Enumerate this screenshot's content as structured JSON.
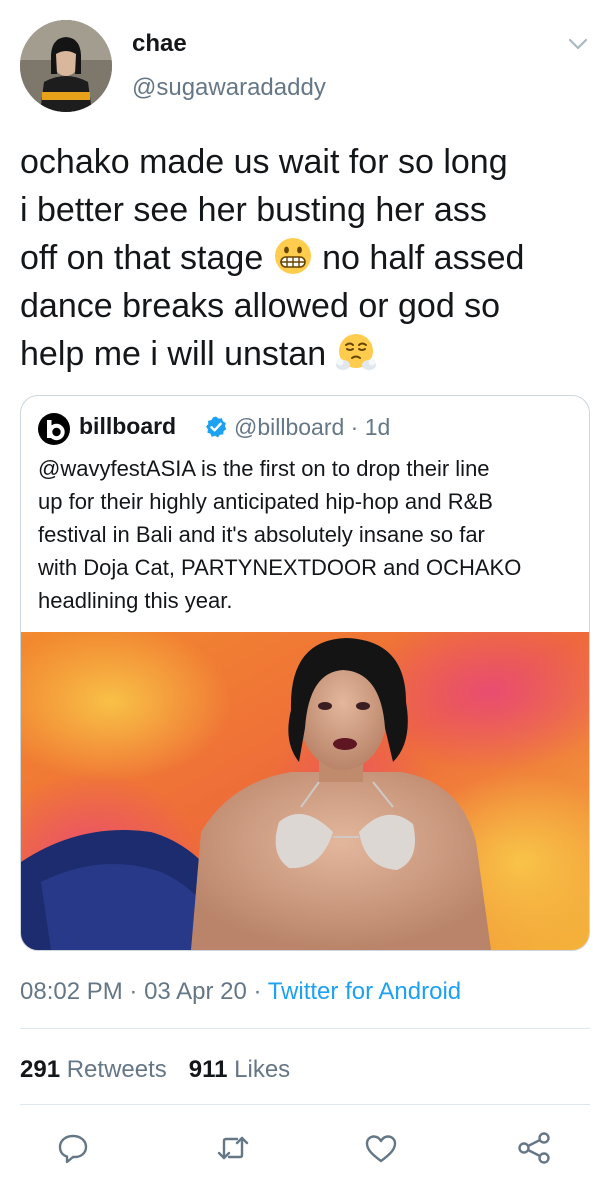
{
  "author": {
    "display_name": "chae",
    "handle": "@sugawaradaddy"
  },
  "tweet": {
    "lines": [
      "ochako made us wait for so long",
      "i better see her busting her ass",
      "off on that stage",
      "no half assed",
      "dance breaks allowed or god so",
      "help me i will unstan"
    ],
    "emoji": [
      "grimacing-face",
      "face-with-steam-from-nose"
    ]
  },
  "quoted": {
    "name": "billboard",
    "handle": "@billboard",
    "separator": " · ",
    "age": "1d",
    "lines": [
      "@wavyfestASIA is the first on to drop their line",
      "up for their highly anticipated hip-hop and R&B",
      "festival in Bali and it's absolutely insane so far",
      "with Doja Cat, PARTYNEXTDOOR and OCHAKO",
      "headlining this year."
    ]
  },
  "meta": {
    "time": "08:02 PM",
    "dot1": " · ",
    "date": "03 Apr 20",
    "dot2": " · ",
    "source": "Twitter for Android"
  },
  "stats": {
    "retweets_count": "291",
    "retweets_label": "Retweets",
    "likes_count": "911",
    "likes_label": "Likes"
  },
  "actions": [
    "reply-icon",
    "retweet-icon",
    "like-icon",
    "share-icon"
  ],
  "colors": {
    "link": "#1da1f2",
    "secondary": "#657786",
    "text": "#14171a",
    "border": "#e1e8ed"
  }
}
